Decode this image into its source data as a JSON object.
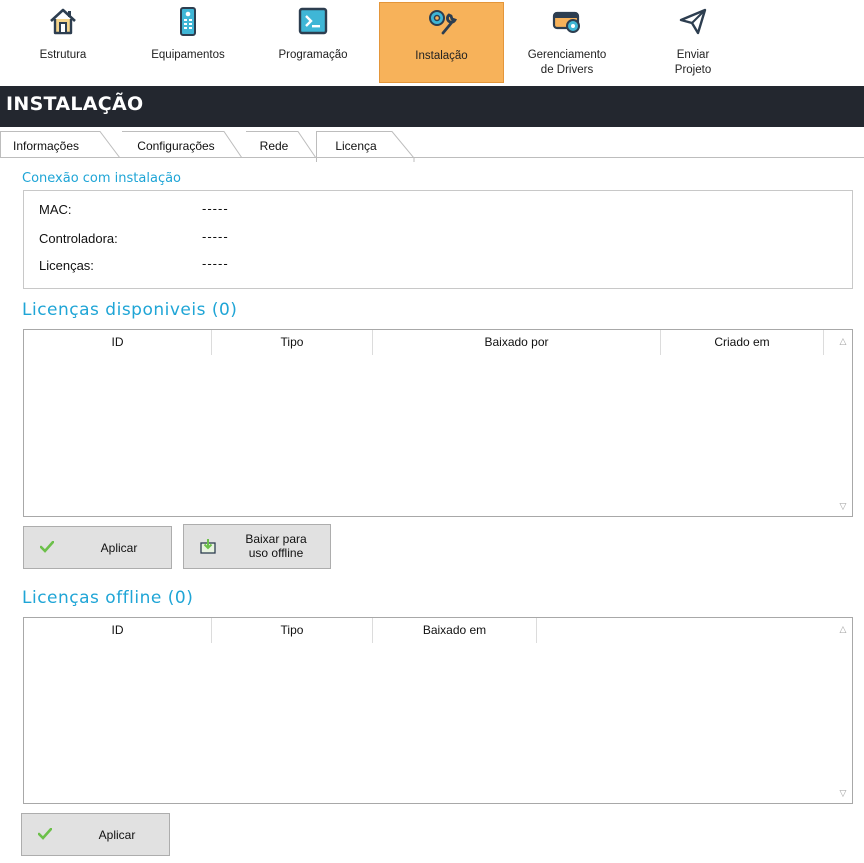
{
  "toolbar": {
    "items": [
      {
        "label": "Estrutura",
        "icon": "house-icon"
      },
      {
        "label": "Equipamentos",
        "icon": "remote-control-icon"
      },
      {
        "label": "Programação",
        "icon": "terminal-icon"
      },
      {
        "label": "Instalação",
        "icon": "wrench-gear-icon"
      },
      {
        "label": "Gerenciamento de Drivers",
        "line1": "Gerenciamento",
        "line2": "de Drivers",
        "icon": "driver-gear-icon"
      },
      {
        "label": "Enviar Projeto",
        "line1": "Enviar",
        "line2": "Projeto",
        "icon": "paper-plane-icon"
      }
    ],
    "active": "Instalação",
    "accent": "#f7b25a"
  },
  "page": {
    "title": "INSTALAÇÃO"
  },
  "tabs": [
    {
      "label": "Informações"
    },
    {
      "label": "Configurações"
    },
    {
      "label": "Rede"
    },
    {
      "label": "Licença"
    }
  ],
  "active_tab": "Licença",
  "connection": {
    "title": "Conexão com instalação",
    "rows": [
      {
        "label": "MAC:",
        "value": "-----"
      },
      {
        "label": "Controladora:",
        "value": "-----"
      },
      {
        "label": "Licenças:",
        "value": "-----"
      }
    ]
  },
  "available": {
    "title": "Licenças disponiveis (0)",
    "columns": [
      "ID",
      "Tipo",
      "Baixado por",
      "Criado em"
    ],
    "rows": [],
    "apply_label": "Aplicar",
    "download_label_line1": "Baixar para",
    "download_label_line2": "uso offline"
  },
  "offline": {
    "title": "Licenças offline (0)",
    "columns": [
      "ID",
      "Tipo",
      "Baixado em"
    ],
    "rows": [],
    "apply_label": "Aplicar"
  },
  "colors": {
    "section_title": "#1fa5d6",
    "titlebar_bg": "#23272f",
    "icon_dark": "#2d3e50",
    "icon_teal": "#3fb6d6",
    "check_green": "#6cc04a"
  }
}
